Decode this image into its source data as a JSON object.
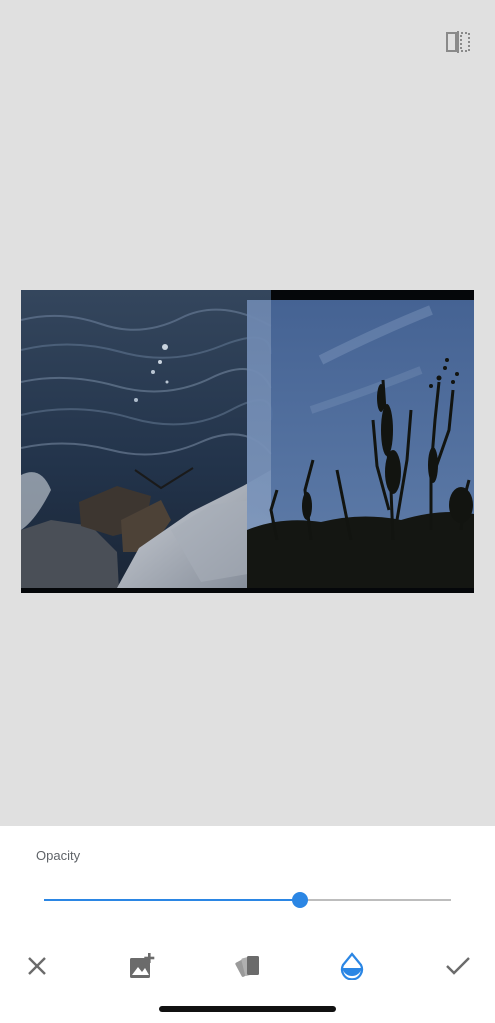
{
  "header": {
    "compare_icon": "compare-split-icon"
  },
  "canvas": {
    "base_image": "ocean-waves-on-rocks-photo",
    "overlay_image": "plants-silhouette-against-blue-sky-photo"
  },
  "panel": {
    "opacity_label": "Opacity",
    "opacity_value": 0.63
  },
  "toolbar": {
    "tools": [
      {
        "name": "cancel",
        "icon": "close-icon",
        "active": false
      },
      {
        "name": "add-image",
        "icon": "add-image-icon",
        "active": false
      },
      {
        "name": "blend-styles",
        "icon": "blend-styles-icon",
        "active": false
      },
      {
        "name": "opacity",
        "icon": "opacity-drop-icon",
        "active": true
      },
      {
        "name": "apply",
        "icon": "checkmark-icon",
        "active": false
      }
    ]
  },
  "colors": {
    "background": "#e0e0e0",
    "panel": "#ffffff",
    "accent": "#2b86e4",
    "icon": "#6b6b6b"
  }
}
